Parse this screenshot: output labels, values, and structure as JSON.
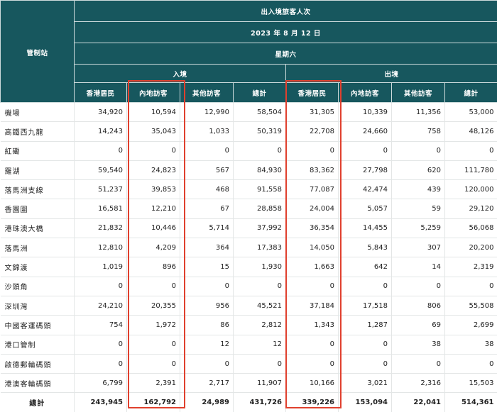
{
  "header": {
    "title": "出入境旅客人次",
    "date": "2023 年 8 月 12 日",
    "weekday": "星期六",
    "station_label": "管制站",
    "arrival_label": "入境",
    "departure_label": "出境",
    "columns": [
      "香港居民",
      "內地訪客",
      "其他訪客",
      "總計",
      "香港居民",
      "內地訪客",
      "其他訪客",
      "總計"
    ]
  },
  "rows": [
    {
      "name": "機場",
      "values": [
        "34,920",
        "10,594",
        "12,990",
        "58,504",
        "31,305",
        "10,339",
        "11,356",
        "53,000"
      ]
    },
    {
      "name": "高鐵西九龍",
      "values": [
        "14,243",
        "35,043",
        "1,033",
        "50,319",
        "22,708",
        "24,660",
        "758",
        "48,126"
      ]
    },
    {
      "name": "紅磡",
      "values": [
        "0",
        "0",
        "0",
        "0",
        "0",
        "0",
        "0",
        "0"
      ]
    },
    {
      "name": "羅湖",
      "values": [
        "59,540",
        "24,823",
        "567",
        "84,930",
        "83,362",
        "27,798",
        "620",
        "111,780"
      ]
    },
    {
      "name": "落馬洲支線",
      "values": [
        "51,237",
        "39,853",
        "468",
        "91,558",
        "77,087",
        "42,474",
        "439",
        "120,000"
      ]
    },
    {
      "name": "香園圍",
      "values": [
        "16,581",
        "12,210",
        "67",
        "28,858",
        "24,004",
        "5,057",
        "59",
        "29,120"
      ]
    },
    {
      "name": "港珠澳大橋",
      "values": [
        "21,832",
        "10,446",
        "5,714",
        "37,992",
        "36,354",
        "14,455",
        "5,259",
        "56,068"
      ]
    },
    {
      "name": "落馬洲",
      "values": [
        "12,810",
        "4,209",
        "364",
        "17,383",
        "14,050",
        "5,843",
        "307",
        "20,200"
      ]
    },
    {
      "name": "文錦渡",
      "values": [
        "1,019",
        "896",
        "15",
        "1,930",
        "1,663",
        "642",
        "14",
        "2,319"
      ]
    },
    {
      "name": "沙頭角",
      "values": [
        "0",
        "0",
        "0",
        "0",
        "0",
        "0",
        "0",
        "0"
      ]
    },
    {
      "name": "深圳灣",
      "values": [
        "24,210",
        "20,355",
        "956",
        "45,521",
        "37,184",
        "17,518",
        "806",
        "55,508"
      ]
    },
    {
      "name": "中國客運碼頭",
      "values": [
        "754",
        "1,972",
        "86",
        "2,812",
        "1,343",
        "1,287",
        "69",
        "2,699"
      ]
    },
    {
      "name": "港口管制",
      "values": [
        "0",
        "0",
        "12",
        "12",
        "0",
        "0",
        "38",
        "38"
      ]
    },
    {
      "name": "啟德郵輪碼頭",
      "values": [
        "0",
        "0",
        "0",
        "0",
        "0",
        "0",
        "0",
        "0"
      ]
    },
    {
      "name": "港澳客輪碼頭",
      "values": [
        "6,799",
        "2,391",
        "2,717",
        "11,907",
        "10,166",
        "3,021",
        "2,316",
        "15,503"
      ]
    },
    {
      "name": "總計",
      "values": [
        "243,945",
        "162,792",
        "24,989",
        "431,726",
        "339,226",
        "153,094",
        "22,041",
        "514,361"
      ]
    }
  ],
  "colors": {
    "header_bg": "#17575e",
    "highlight": "#e0402e"
  }
}
